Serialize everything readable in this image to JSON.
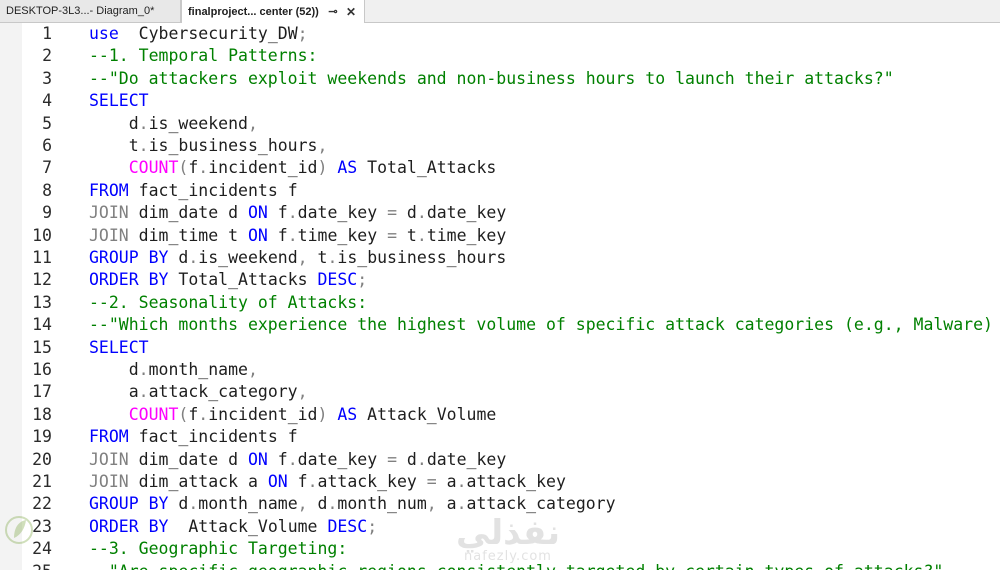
{
  "tabs": [
    {
      "label": "DESKTOP-3L3...- Diagram_0*",
      "active": false
    },
    {
      "label": "finalproject... center (52))",
      "active": true,
      "pin_glyph": "⊸",
      "close_glyph": "✕"
    }
  ],
  "lines": [
    {
      "n": "1",
      "tokens": [
        [
          "kw",
          "use"
        ],
        [
          "",
          "  Cybersecurity_DW"
        ],
        [
          "gr",
          ";"
        ]
      ]
    },
    {
      "n": "2",
      "tokens": [
        [
          "cm",
          "--1. Temporal Patterns:"
        ]
      ]
    },
    {
      "n": "3",
      "tokens": [
        [
          "cm",
          "--\"Do attackers exploit weekends and non-business hours to launch their attacks?\""
        ]
      ]
    },
    {
      "n": "4",
      "tokens": [
        [
          "kw",
          "SELECT"
        ]
      ]
    },
    {
      "n": "5",
      "tokens": [
        [
          "",
          "    d"
        ],
        [
          "gr",
          "."
        ],
        [
          "",
          "is_weekend"
        ],
        [
          "gr",
          ","
        ]
      ]
    },
    {
      "n": "6",
      "tokens": [
        [
          "",
          "    t"
        ],
        [
          "gr",
          "."
        ],
        [
          "",
          "is_business_hours"
        ],
        [
          "gr",
          ","
        ]
      ]
    },
    {
      "n": "7",
      "tokens": [
        [
          "fn",
          "    COUNT"
        ],
        [
          "gr",
          "("
        ],
        [
          "",
          "f"
        ],
        [
          "gr",
          "."
        ],
        [
          "",
          "incident_id"
        ],
        [
          "gr",
          ")"
        ],
        [
          "",
          " "
        ],
        [
          "kw",
          "AS"
        ],
        [
          "",
          " Total_Attacks"
        ]
      ]
    },
    {
      "n": "8",
      "tokens": [
        [
          "kw",
          "FROM"
        ],
        [
          "",
          " fact_incidents f"
        ]
      ]
    },
    {
      "n": "9",
      "tokens": [
        [
          "gr",
          "JOIN"
        ],
        [
          "",
          " dim_date d "
        ],
        [
          "kw",
          "ON"
        ],
        [
          "",
          " f"
        ],
        [
          "gr",
          "."
        ],
        [
          "",
          "date_key "
        ],
        [
          "gr",
          "="
        ],
        [
          "",
          " d"
        ],
        [
          "gr",
          "."
        ],
        [
          "",
          "date_key"
        ]
      ]
    },
    {
      "n": "10",
      "tokens": [
        [
          "gr",
          "JOIN"
        ],
        [
          "",
          " dim_time t "
        ],
        [
          "kw",
          "ON"
        ],
        [
          "",
          " f"
        ],
        [
          "gr",
          "."
        ],
        [
          "",
          "time_key "
        ],
        [
          "gr",
          "="
        ],
        [
          "",
          " t"
        ],
        [
          "gr",
          "."
        ],
        [
          "",
          "time_key"
        ]
      ]
    },
    {
      "n": "11",
      "tokens": [
        [
          "kw",
          "GROUP BY"
        ],
        [
          "",
          " d"
        ],
        [
          "gr",
          "."
        ],
        [
          "",
          "is_weekend"
        ],
        [
          "gr",
          ","
        ],
        [
          "",
          " t"
        ],
        [
          "gr",
          "."
        ],
        [
          "",
          "is_business_hours"
        ]
      ]
    },
    {
      "n": "12",
      "tokens": [
        [
          "kw",
          "ORDER BY"
        ],
        [
          "",
          " Total_Attacks "
        ],
        [
          "kw",
          "DESC"
        ],
        [
          "gr",
          ";"
        ]
      ]
    },
    {
      "n": "13",
      "tokens": [
        [
          "cm",
          "--2. Seasonality of Attacks:"
        ]
      ]
    },
    {
      "n": "14",
      "tokens": [
        [
          "cm",
          "--\"Which months experience the highest volume of specific attack categories (e.g., Malware)"
        ]
      ]
    },
    {
      "n": "15",
      "tokens": [
        [
          "kw",
          "SELECT"
        ]
      ]
    },
    {
      "n": "16",
      "tokens": [
        [
          "",
          "    d"
        ],
        [
          "gr",
          "."
        ],
        [
          "",
          "month_name"
        ],
        [
          "gr",
          ","
        ]
      ]
    },
    {
      "n": "17",
      "tokens": [
        [
          "",
          "    a"
        ],
        [
          "gr",
          "."
        ],
        [
          "",
          "attack_category"
        ],
        [
          "gr",
          ","
        ]
      ]
    },
    {
      "n": "18",
      "tokens": [
        [
          "fn",
          "    COUNT"
        ],
        [
          "gr",
          "("
        ],
        [
          "",
          "f"
        ],
        [
          "gr",
          "."
        ],
        [
          "",
          "incident_id"
        ],
        [
          "gr",
          ")"
        ],
        [
          "",
          " "
        ],
        [
          "kw",
          "AS"
        ],
        [
          "",
          " Attack_Volume"
        ]
      ]
    },
    {
      "n": "19",
      "tokens": [
        [
          "kw",
          "FROM"
        ],
        [
          "",
          " fact_incidents f"
        ]
      ]
    },
    {
      "n": "20",
      "tokens": [
        [
          "gr",
          "JOIN"
        ],
        [
          "",
          " dim_date d "
        ],
        [
          "kw",
          "ON"
        ],
        [
          "",
          " f"
        ],
        [
          "gr",
          "."
        ],
        [
          "",
          "date_key "
        ],
        [
          "gr",
          "="
        ],
        [
          "",
          " d"
        ],
        [
          "gr",
          "."
        ],
        [
          "",
          "date_key"
        ]
      ]
    },
    {
      "n": "21",
      "tokens": [
        [
          "gr",
          "JOIN"
        ],
        [
          "",
          " dim_attack a "
        ],
        [
          "kw",
          "ON"
        ],
        [
          "",
          " f"
        ],
        [
          "gr",
          "."
        ],
        [
          "",
          "attack_key "
        ],
        [
          "gr",
          "="
        ],
        [
          "",
          " a"
        ],
        [
          "gr",
          "."
        ],
        [
          "",
          "attack_key"
        ]
      ]
    },
    {
      "n": "22",
      "tokens": [
        [
          "kw",
          "GROUP BY"
        ],
        [
          "",
          " d"
        ],
        [
          "gr",
          "."
        ],
        [
          "",
          "month_name"
        ],
        [
          "gr",
          ","
        ],
        [
          "",
          " d"
        ],
        [
          "gr",
          "."
        ],
        [
          "",
          "month_num"
        ],
        [
          "gr",
          ","
        ],
        [
          "",
          " a"
        ],
        [
          "gr",
          "."
        ],
        [
          "",
          "attack_category"
        ]
      ]
    },
    {
      "n": "23",
      "tokens": [
        [
          "kw",
          "ORDER BY"
        ],
        [
          "",
          "  Attack_Volume "
        ],
        [
          "kw",
          "DESC"
        ],
        [
          "gr",
          ";"
        ]
      ]
    },
    {
      "n": "24",
      "tokens": [
        [
          "cm",
          "--3. Geographic Targeting:"
        ]
      ]
    },
    {
      "n": "25",
      "tokens": [
        [
          "cm",
          "--\"Are specific geographic regions consistently targeted by certain types of attacks?\""
        ]
      ]
    }
  ],
  "watermark": {
    "arabic": "نفذلي",
    "latin": "nafezly.com"
  },
  "colors": {
    "keyword": "#0000ff",
    "operator": "#808080",
    "function": "#ff00ff",
    "comment": "#008000",
    "text": "#1e1e1e"
  },
  "icons": {
    "pin": "pin-icon",
    "close": "close-icon",
    "logo": "leaf-logo-icon"
  }
}
